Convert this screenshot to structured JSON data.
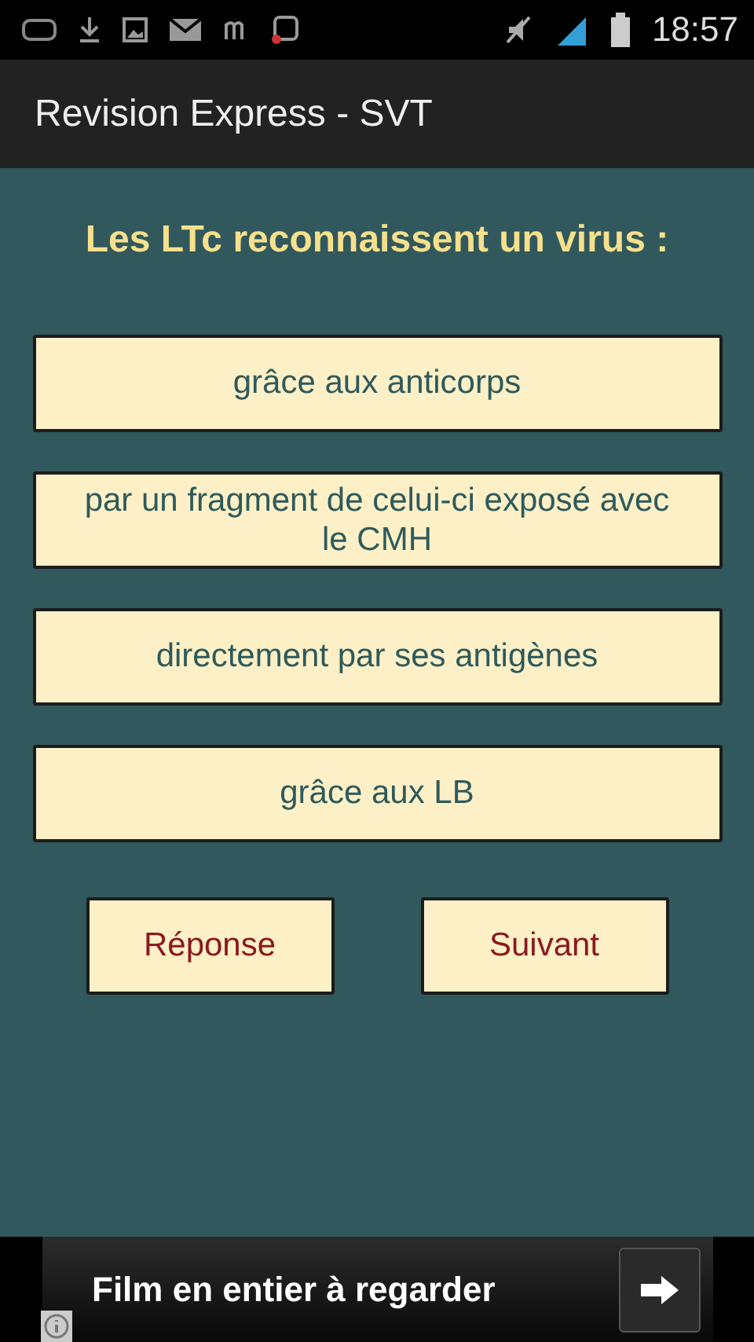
{
  "status_bar": {
    "time": "18:57"
  },
  "app_bar": {
    "title": "Revision Express - SVT"
  },
  "question": "Les LTc reconnaissent un virus :",
  "answers": [
    "grâce aux anticorps",
    "par un fragment de celui-ci exposé avec le CMH",
    "directement par ses  antigènes",
    "grâce aux LB"
  ],
  "actions": [
    "Réponse",
    "Suivant"
  ],
  "ad": {
    "text": "Film en entier à regarder"
  }
}
